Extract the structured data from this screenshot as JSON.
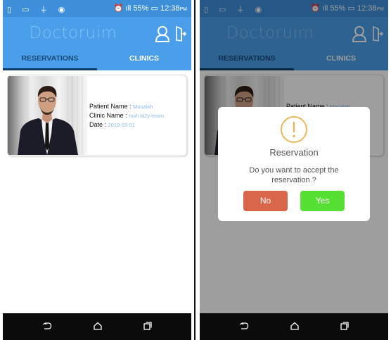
{
  "status_bar": {
    "battery": "55%",
    "time": "12:38",
    "ampm": "PM"
  },
  "app": {
    "title": "Doctoruim"
  },
  "tabs": [
    {
      "label": "RESERVATIONS",
      "selected": true
    },
    {
      "label": "CLINICS",
      "selected": false
    }
  ],
  "reservation": {
    "patient_label": "Patient Name :",
    "patient_value": "Mosalah",
    "clinic_label": "Clinic Name :",
    "clinic_value": "msh la2y essm",
    "date_label": "Date :",
    "date_value": "2019-03-01"
  },
  "dialog": {
    "title": "Reservation",
    "message": "Do you want to accept the reservation ?",
    "no_label": "No",
    "yes_label": "Yes"
  },
  "colors": {
    "app_bar": "#4a9eea",
    "status_bar": "#3d8fd9",
    "tab_indicator": "#0a3c6a",
    "no_button": "#d9664b",
    "yes_button": "#55e033",
    "warning_icon": "#f0b55a"
  },
  "icons": {
    "user": "user-icon",
    "logout": "logout-icon",
    "back": "back-icon",
    "home": "home-icon",
    "recent": "recent-apps-icon",
    "warning": "warning-circle-icon"
  }
}
